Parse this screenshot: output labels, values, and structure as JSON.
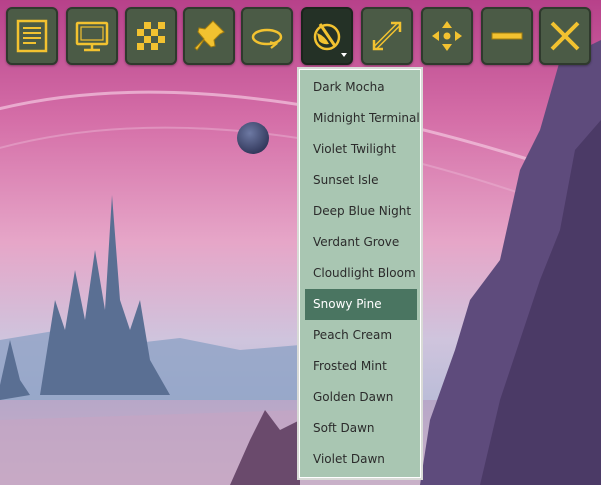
{
  "toolbar": {
    "buttons": [
      {
        "icon": "list-panel-icon"
      },
      {
        "icon": "monitor-icon"
      },
      {
        "icon": "checkerboard-icon"
      },
      {
        "icon": "pushpin-icon"
      },
      {
        "icon": "rotate-loop-icon"
      },
      {
        "icon": "theme-palette-icon",
        "active": true,
        "has_dropdown": true
      },
      {
        "icon": "resize-diagonal-icon"
      },
      {
        "icon": "move-arrows-icon"
      },
      {
        "icon": "minimize-icon"
      },
      {
        "icon": "close-icon"
      }
    ]
  },
  "theme_menu": {
    "items": [
      "Dark Mocha",
      "Midnight Terminal",
      "Violet Twilight",
      "Sunset Isle",
      "Deep Blue Night",
      "Verdant Grove",
      "Cloudlight Bloom",
      "Snowy Pine",
      "Peach Cream",
      "Frosted Mint",
      "Golden Dawn",
      "Soft Dawn",
      "Violet Dawn"
    ],
    "selected": "Snowy Pine"
  },
  "colors": {
    "accent_gold": "#f2c230",
    "button_bg": "#4b5b46",
    "menu_bg": "#a9c6b2",
    "menu_selected": "#4a7561"
  }
}
